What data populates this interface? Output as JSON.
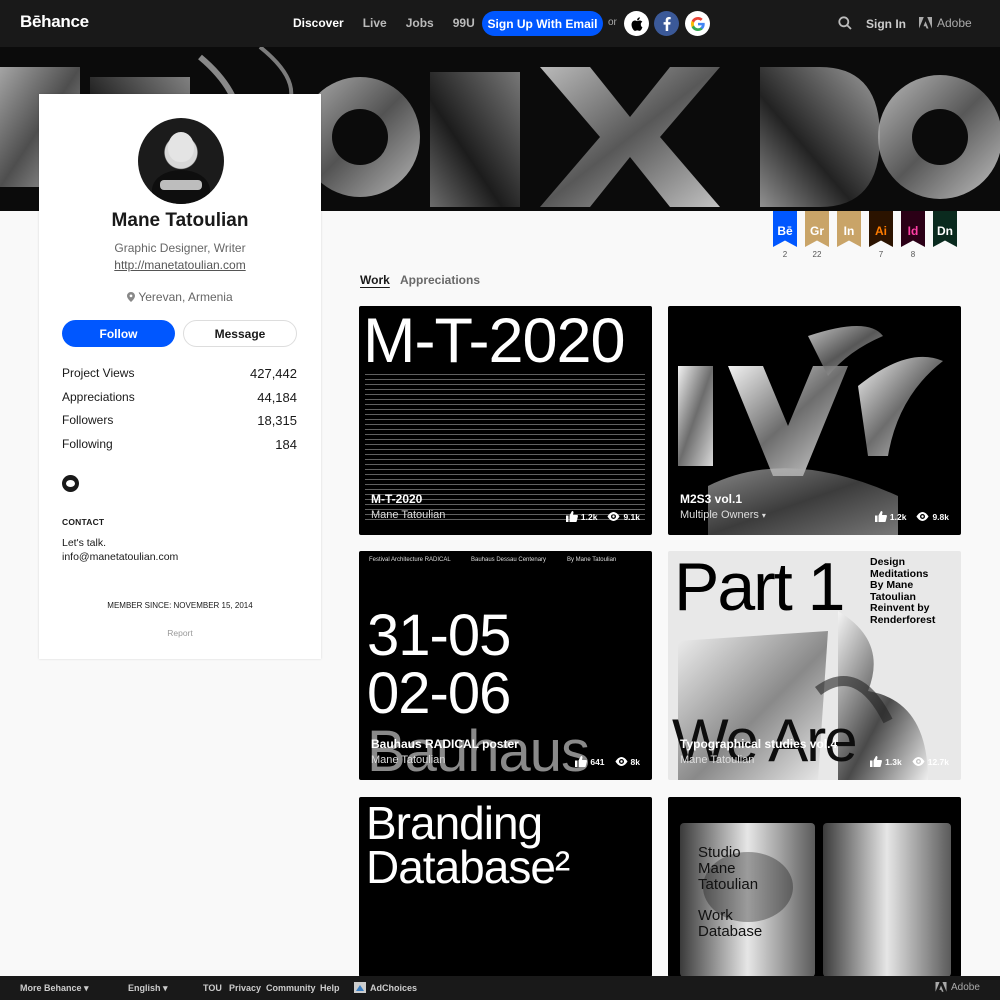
{
  "header": {
    "logo": "Bēhance",
    "nav": [
      "Discover",
      "Live",
      "Jobs",
      "99U"
    ],
    "signup_label": "Sign Up With Email",
    "or_label": "or",
    "signin_label": "Sign In",
    "adobe_label": "Adobe"
  },
  "profile": {
    "name": "Mane Tatoulian",
    "title": "Graphic Designer, Writer",
    "website": "http://manetatoulian.com",
    "location": "Yerevan, Armenia",
    "follow_label": "Follow",
    "message_label": "Message",
    "stats": [
      {
        "label": "Project Views",
        "value": "427,442"
      },
      {
        "label": "Appreciations",
        "value": "44,184"
      },
      {
        "label": "Followers",
        "value": "18,315"
      },
      {
        "label": "Following",
        "value": "184"
      }
    ],
    "contact_heading": "CONTACT",
    "contact_text": "Let's talk.",
    "contact_email": "info@manetatoulian.com",
    "member_since": "MEMBER SINCE: NOVEMBER 15, 2014",
    "report_label": "Report"
  },
  "badges": [
    {
      "label": "Bē",
      "count": "2",
      "bg": "#0057ff",
      "fg": "#ffffff"
    },
    {
      "label": "Gr",
      "count": "22",
      "bg": "#c9a468",
      "fg": "#ffffff"
    },
    {
      "label": "In",
      "count": "",
      "bg": "#c9a468",
      "fg": "#ffffff"
    },
    {
      "label": "Ai",
      "count": "7",
      "bg": "#2b1300",
      "fg": "#ff7c00"
    },
    {
      "label": "Id",
      "count": "8",
      "bg": "#2b0016",
      "fg": "#ff3ea5"
    },
    {
      "label": "Dn",
      "count": "",
      "bg": "#0a2a1e",
      "fg": "#ffffff"
    }
  ],
  "tabs": [
    "Work",
    "Appreciations"
  ],
  "projects": [
    {
      "title": "M-T-2020",
      "owner": "Mane Tatoulian",
      "likes": "1.2k",
      "views": "9.1k",
      "art": "M-T-2020"
    },
    {
      "title": "M2S3 vol.1",
      "owner": "Multiple Owners",
      "likes": "1.2k",
      "views": "9.8k"
    },
    {
      "title": "Bauhaus RADICAL poster",
      "owner": "Mane Tatoulian",
      "likes": "641",
      "views": "8k",
      "art_header": [
        "Festival Architecture RADICAL",
        "Bauhaus Dessau Centenary",
        "By Mane Tatoulian"
      ],
      "art_big": [
        "31-05",
        "02-06",
        "Bauhaus"
      ]
    },
    {
      "title": "Typographical studies vol.4",
      "owner": "Mane Tatoulian",
      "likes": "1.3k",
      "views": "12.7k",
      "art_big": "Part 1",
      "art_side": [
        "Design",
        "Meditations",
        "By Mane",
        "Tatoulian",
        "Reinvent by",
        "Renderforest"
      ],
      "art_bottom": "We Are"
    },
    {
      "art": [
        "Branding",
        "Database²"
      ]
    },
    {
      "art": [
        "Studio",
        "Mane",
        "Tatoulian",
        "Work",
        "Database"
      ]
    }
  ],
  "footer": {
    "items": [
      "More Behance ▾",
      "English ▾",
      "TOU",
      "Privacy",
      "Community",
      "Help",
      "AdChoices"
    ],
    "adobe_label": "Adobe"
  },
  "colors": {
    "accent": "#0057ff",
    "dark": "#191919"
  }
}
